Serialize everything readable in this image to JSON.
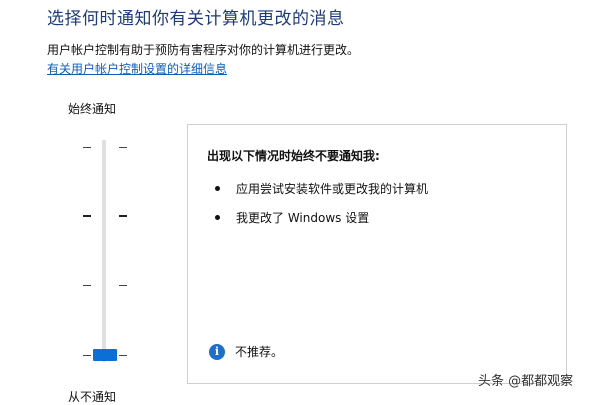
{
  "header": {
    "title": "选择何时通知你有关计算机更改的消息",
    "description": "用户帐户控制有助于预防有害程序对你的计算机进行更改。",
    "details_link": "有关用户帐户控制设置的详细信息"
  },
  "slider": {
    "top_label": "始终通知",
    "bottom_label": "从不通知",
    "level": 0,
    "levels_total": 4
  },
  "panel": {
    "heading": "出现以下情况时始终不要通知我:",
    "bullets": [
      "应用尝试安装软件或更改我的计算机",
      "我更改了 Windows 设置"
    ],
    "recommendation": "不推荐。",
    "recommendation_icon": "info-icon"
  },
  "watermark": {
    "text": "头条 @都都观察"
  },
  "colors": {
    "title": "#1e3a78",
    "link": "#0b5fb8",
    "thumb": "#0b6fd6",
    "info_icon": "#1e6fc8"
  }
}
